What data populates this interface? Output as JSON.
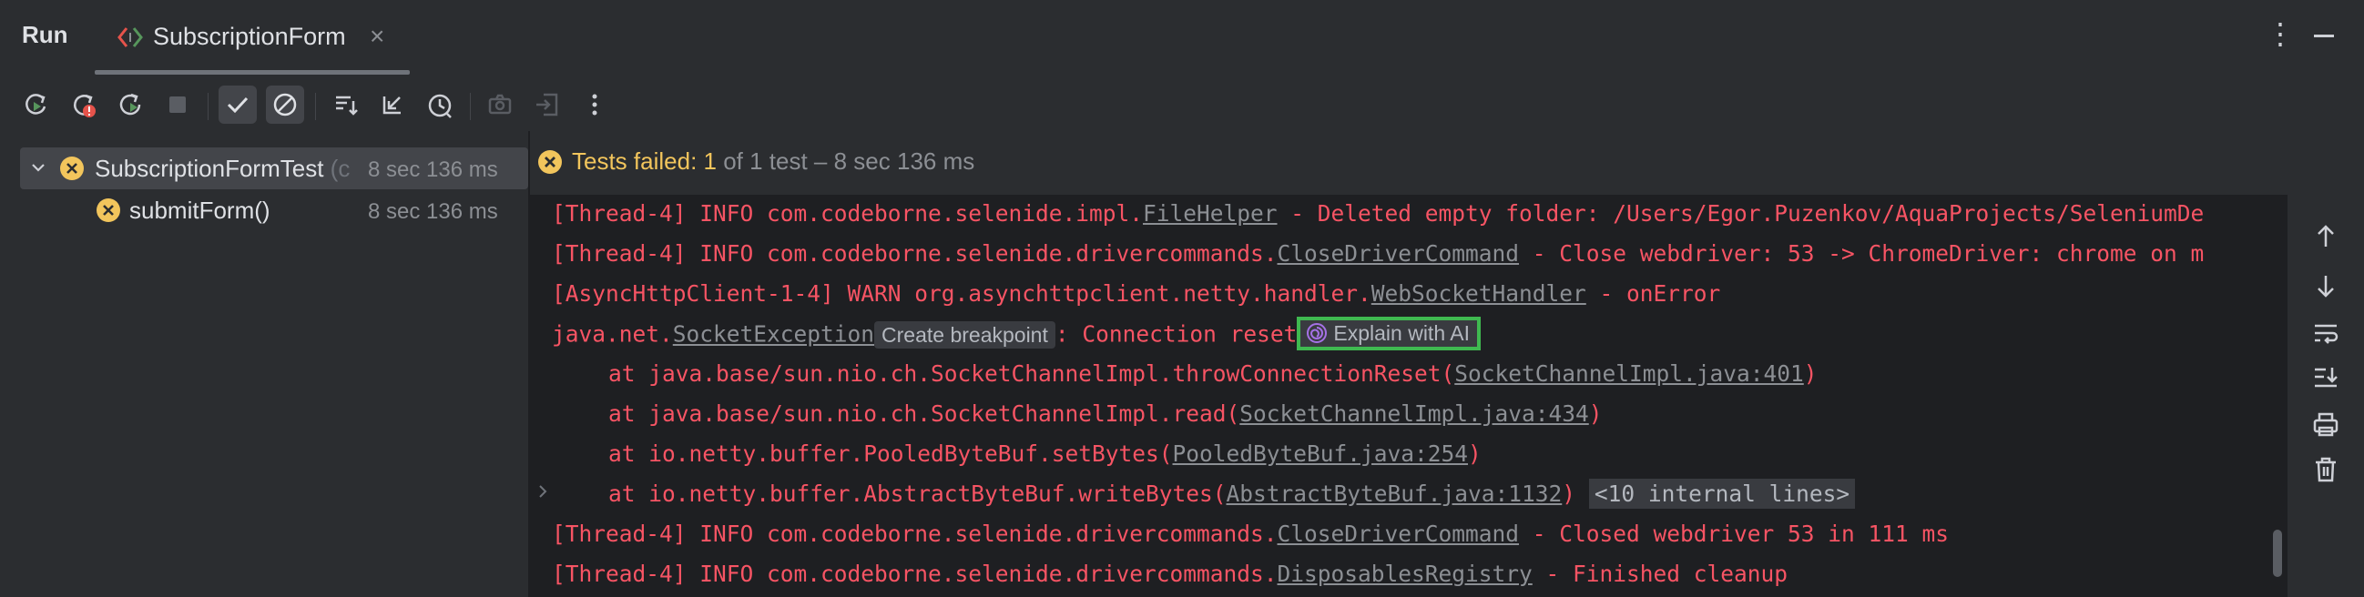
{
  "header": {
    "title": "Run",
    "tab": {
      "label": "SubscriptionForm",
      "close": "×"
    },
    "more": "⋮"
  },
  "toolbar": {
    "buttons": [
      "rerun-icon",
      "rerun-failed-icon",
      "toggle-auto-test-icon",
      "stop-icon",
      "show-passed-icon",
      "show-ignored-icon",
      "sort-icon",
      "collapse-all-icon",
      "test-history-icon",
      "screenshot-icon",
      "export-icon",
      "more-icon"
    ]
  },
  "tree": {
    "root": {
      "label": "SubscriptionFormTest",
      "suffix": "(c",
      "time": "8 sec 136 ms"
    },
    "child": {
      "label": "submitForm()",
      "time": "8 sec 136 ms"
    }
  },
  "status": {
    "failed": "Tests failed: 1",
    "rest": " of 1 test – 8 sec 136 ms"
  },
  "console": {
    "l1_pre": "[Thread-4] INFO com.codeborne.selenide.impl.",
    "l1_link": "FileHelper",
    "l1_post": " - Deleted empty folder: /Users/Egor.Puzenkov/AquaProjects/SeleniumDe",
    "l2_pre": "[Thread-4] INFO com.codeborne.selenide.drivercommands.",
    "l2_link": "CloseDriverCommand",
    "l2_post": " - Close webdriver: 53 -> ChromeDriver: chrome on m",
    "l3_pre": "[AsyncHttpClient-1-4] WARN org.asynchttpclient.netty.handler.",
    "l3_link": "WebSocketHandler",
    "l3_post": " - onError",
    "l4_pre": "java.net.",
    "l4_link": "SocketException",
    "l4_hint": "Create breakpoint",
    "l4_post": ": Connection reset",
    "ai_button": "Explain with AI",
    "l5_pre": "at java.base/sun.nio.ch.SocketChannelImpl.throwConnectionReset(",
    "l5_link": "SocketChannelImpl.java:401",
    "l5_post": ")",
    "l6_pre": "at java.base/sun.nio.ch.SocketChannelImpl.read(",
    "l6_link": "SocketChannelImpl.java:434",
    "l6_post": ")",
    "l7_pre": "at io.netty.buffer.PooledByteBuf.setBytes(",
    "l7_link": "PooledByteBuf.java:254",
    "l7_post": ")",
    "l8_pre": "at io.netty.buffer.AbstractByteBuf.writeBytes(",
    "l8_link": "AbstractByteBuf.java:1132",
    "l8_post": ")",
    "l8_internal": "<10 internal lines>",
    "l9_pre": "[Thread-4] INFO com.codeborne.selenide.drivercommands.",
    "l9_link": "CloseDriverCommand",
    "l9_post": " - Closed webdriver 53 in 111 ms",
    "l10_pre": "[Thread-4] INFO com.codeborne.selenide.drivercommands.",
    "l10_link": "DisposablesRegistry",
    "l10_post": " - Finished cleanup"
  },
  "side_actions": [
    "up-arrow-icon",
    "down-arrow-icon",
    "soft-wrap-icon",
    "scroll-to-end-icon",
    "print-icon",
    "trash-icon"
  ],
  "colors": {
    "background": "#2b2d30",
    "console_bg": "#1e1f22",
    "error_text": "#f75464",
    "warning": "#f2c55c",
    "ai_highlight": "#3fb950"
  }
}
